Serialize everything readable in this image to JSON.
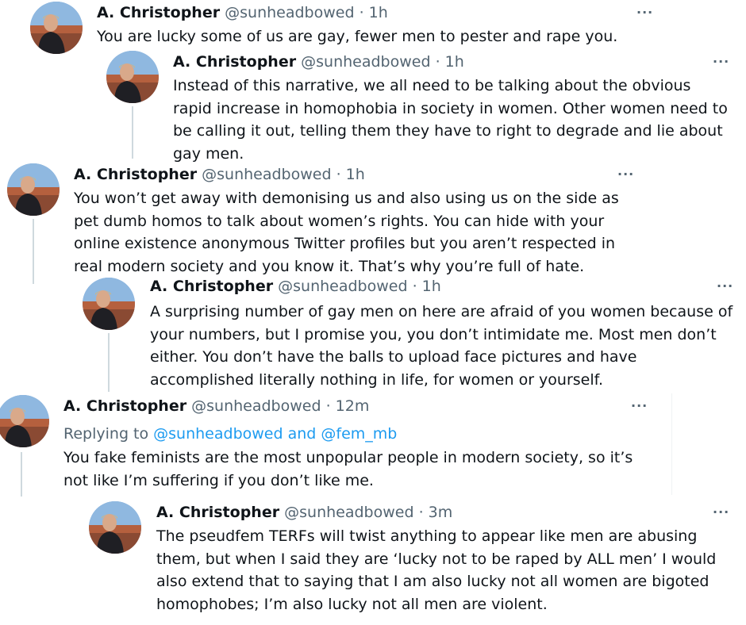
{
  "tweets": [
    {
      "name": "A. Christopher",
      "handle": "@sunheadbowed",
      "sep": " · ",
      "time": "1h",
      "more": "···",
      "text": "You are lucky some of us are gay, fewer men to pester and rape you."
    },
    {
      "name": "A. Christopher",
      "handle": "@sunheadbowed",
      "sep": " · ",
      "time": "1h",
      "more": "···",
      "text": "Instead of this narrative, we all need to be talking about the obvious rapid increase in homophobia in society in women. Other women need to be calling it out, telling them they have to right to degrade and lie about gay men."
    },
    {
      "name": "A. Christopher",
      "handle": "@sunheadbowed",
      "sep": " · ",
      "time": "1h",
      "more": "···",
      "text": "You won’t get away with demonising us and also using us on the side as pet dumb homos to talk about women’s rights. You can hide with your online existence anonymous Twitter profiles but you aren’t respected in real modern society and you know it. That’s why you’re full of hate."
    },
    {
      "name": "A. Christopher",
      "handle": "@sunheadbowed",
      "sep": " · ",
      "time": "1h",
      "more": "···",
      "text": "A surprising number of gay men on here are afraid of you women because of your numbers, but I promise you, you don’t intimidate me. Most men don’t either. You don’t have the balls to upload face pictures and have accomplished literally nothing in life, for women or yourself."
    },
    {
      "name": "A. Christopher",
      "handle": "@sunheadbowed",
      "sep": " · ",
      "time": "12m",
      "more": "···",
      "replying_prefix": "Replying to ",
      "replying_link": "@sunheadbowed and @fem_mb",
      "text": "You fake feminists are the most unpopular people in modern society, so it’s not like I’m suffering if you don’t like me."
    },
    {
      "name": "A. Christopher",
      "handle": "@sunheadbowed",
      "sep": " · ",
      "time": "3m",
      "more": "···",
      "text": "The pseudfem TERFs will twist anything to appear like men are abusing them, but when I said they are ‘lucky not to be raped by ALL men’ I would also extend that to saying that I am also lucky not all women are bigoted homophobes; I’m also lucky not all men are violent."
    }
  ],
  "colors": {
    "text": "#0f1419",
    "secondary": "#536471",
    "link": "#1d9bf0",
    "thread_line": "#cfd9de"
  },
  "icons": {
    "avatar": "profile-photo",
    "more": "more-horizontal-icon"
  }
}
